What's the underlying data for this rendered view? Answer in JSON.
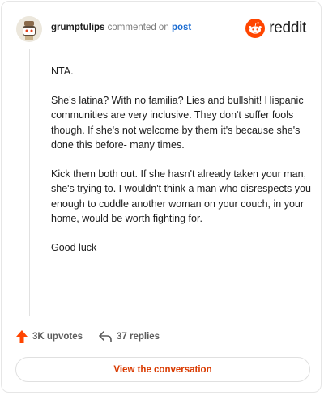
{
  "header": {
    "username": "grumptulips",
    "action": "commented on",
    "post_link": "post",
    "brand_name": "reddit",
    "brand_color": "#ff4500"
  },
  "comment": {
    "paragraphs": [
      "NTA.",
      "She's latina? With no familia? Lies and bullshit! Hispanic communities are very inclusive. They don't suffer fools though. If she's not welcome by them it's because she's done this before- many times.",
      "Kick them both out. If she hasn't already taken your man, she's trying to. I wouldn't think a man who disrespects you enough to cuddle another woman on your couch, in your home, would be worth fighting for.",
      "Good luck"
    ]
  },
  "stats": {
    "upvotes": "3K upvotes",
    "replies": "37 replies",
    "upvote_icon": "upvote-arrow-icon",
    "reply_icon": "reply-arrow-icon"
  },
  "cta": {
    "label": "View the conversation",
    "color": "#d93a00"
  }
}
